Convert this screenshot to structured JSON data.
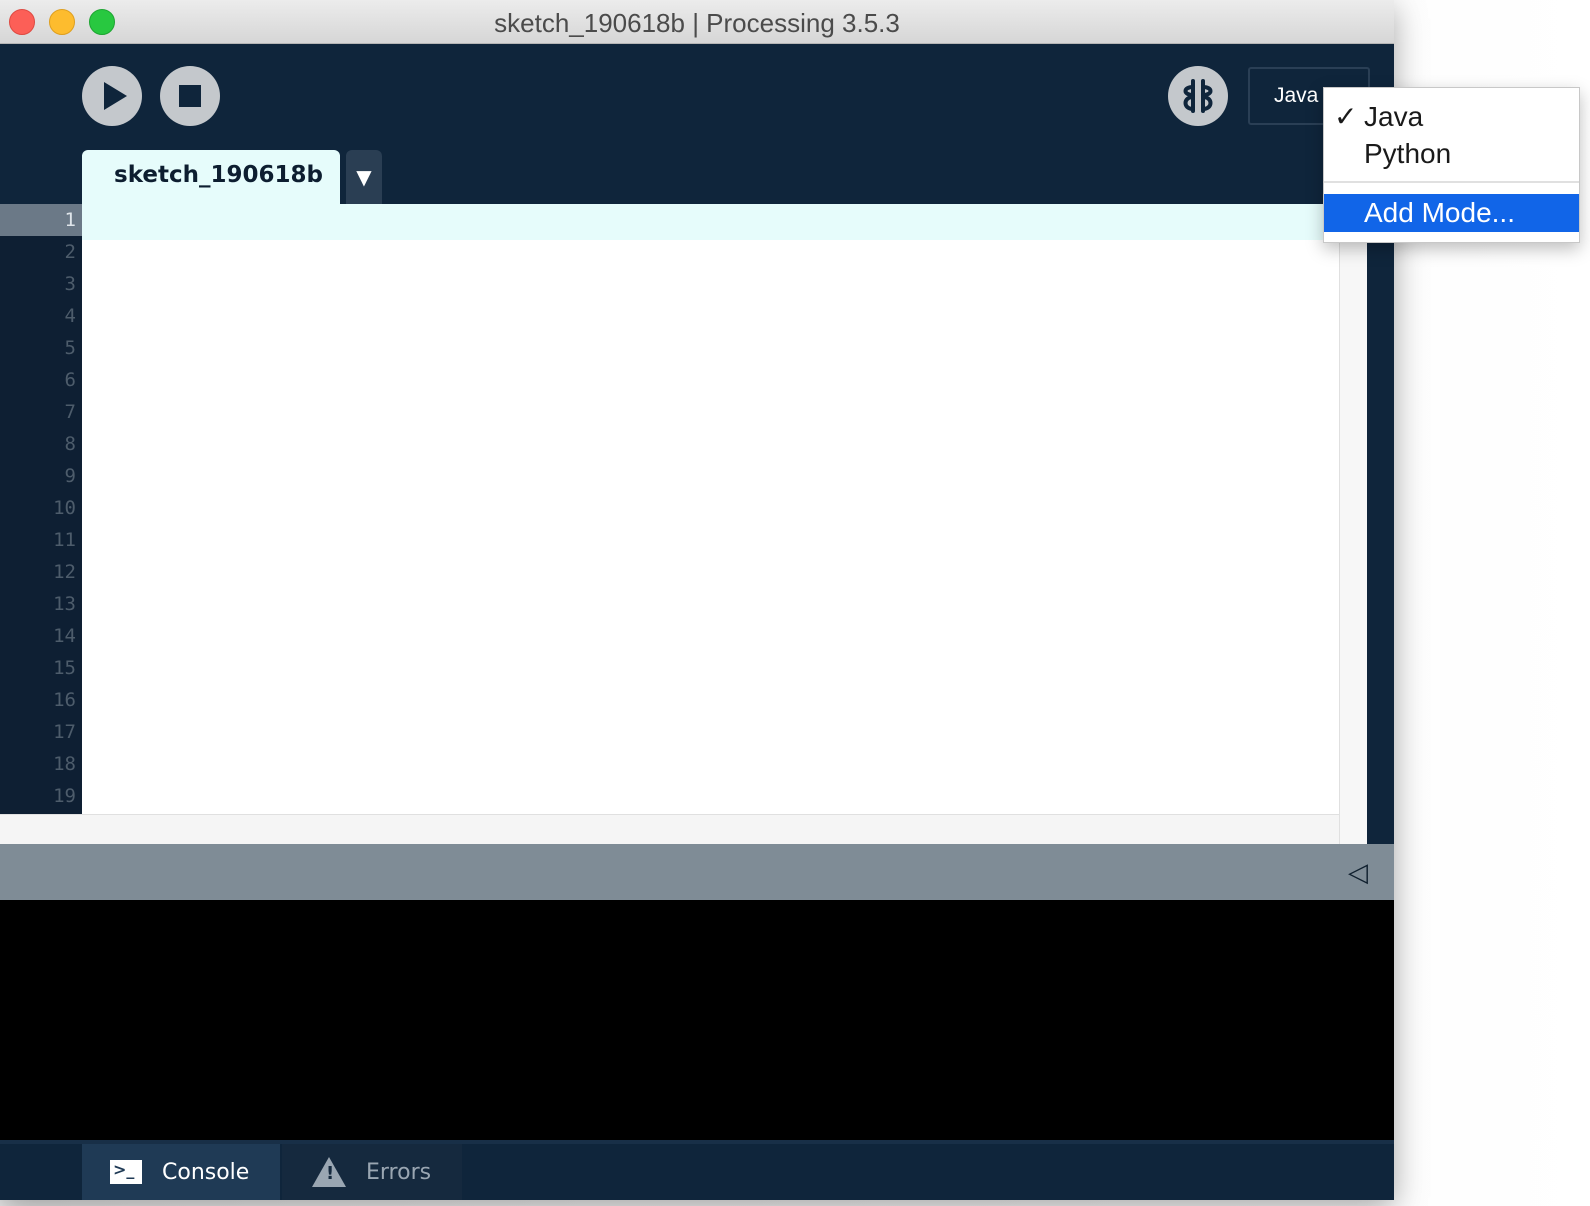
{
  "window": {
    "title": "sketch_190618b | Processing 3.5.3"
  },
  "toolbar": {
    "mode_label": "Java"
  },
  "tabs": [
    {
      "label": "sketch_190618b",
      "menu_glyph": "▼"
    }
  ],
  "editor": {
    "line_numbers": [
      "1",
      "2",
      "3",
      "4",
      "5",
      "6",
      "7",
      "8",
      "9",
      "10",
      "11",
      "12",
      "13",
      "14",
      "15",
      "16",
      "17",
      "18",
      "19"
    ],
    "current_line": "1"
  },
  "mode_menu": {
    "items": [
      {
        "label": "Java",
        "checked": true,
        "check_glyph": "✓"
      },
      {
        "label": "Python",
        "checked": false
      },
      {
        "label": "Add Mode...",
        "highlighted": true
      }
    ]
  },
  "footer": {
    "console_label": "Console",
    "errors_label": "Errors"
  },
  "icons": {
    "collapse": "◁"
  },
  "colors": {
    "toolbar_bg": "#0f253b",
    "active_line": "#e6fcfb",
    "menu_highlight": "#1165e8"
  }
}
